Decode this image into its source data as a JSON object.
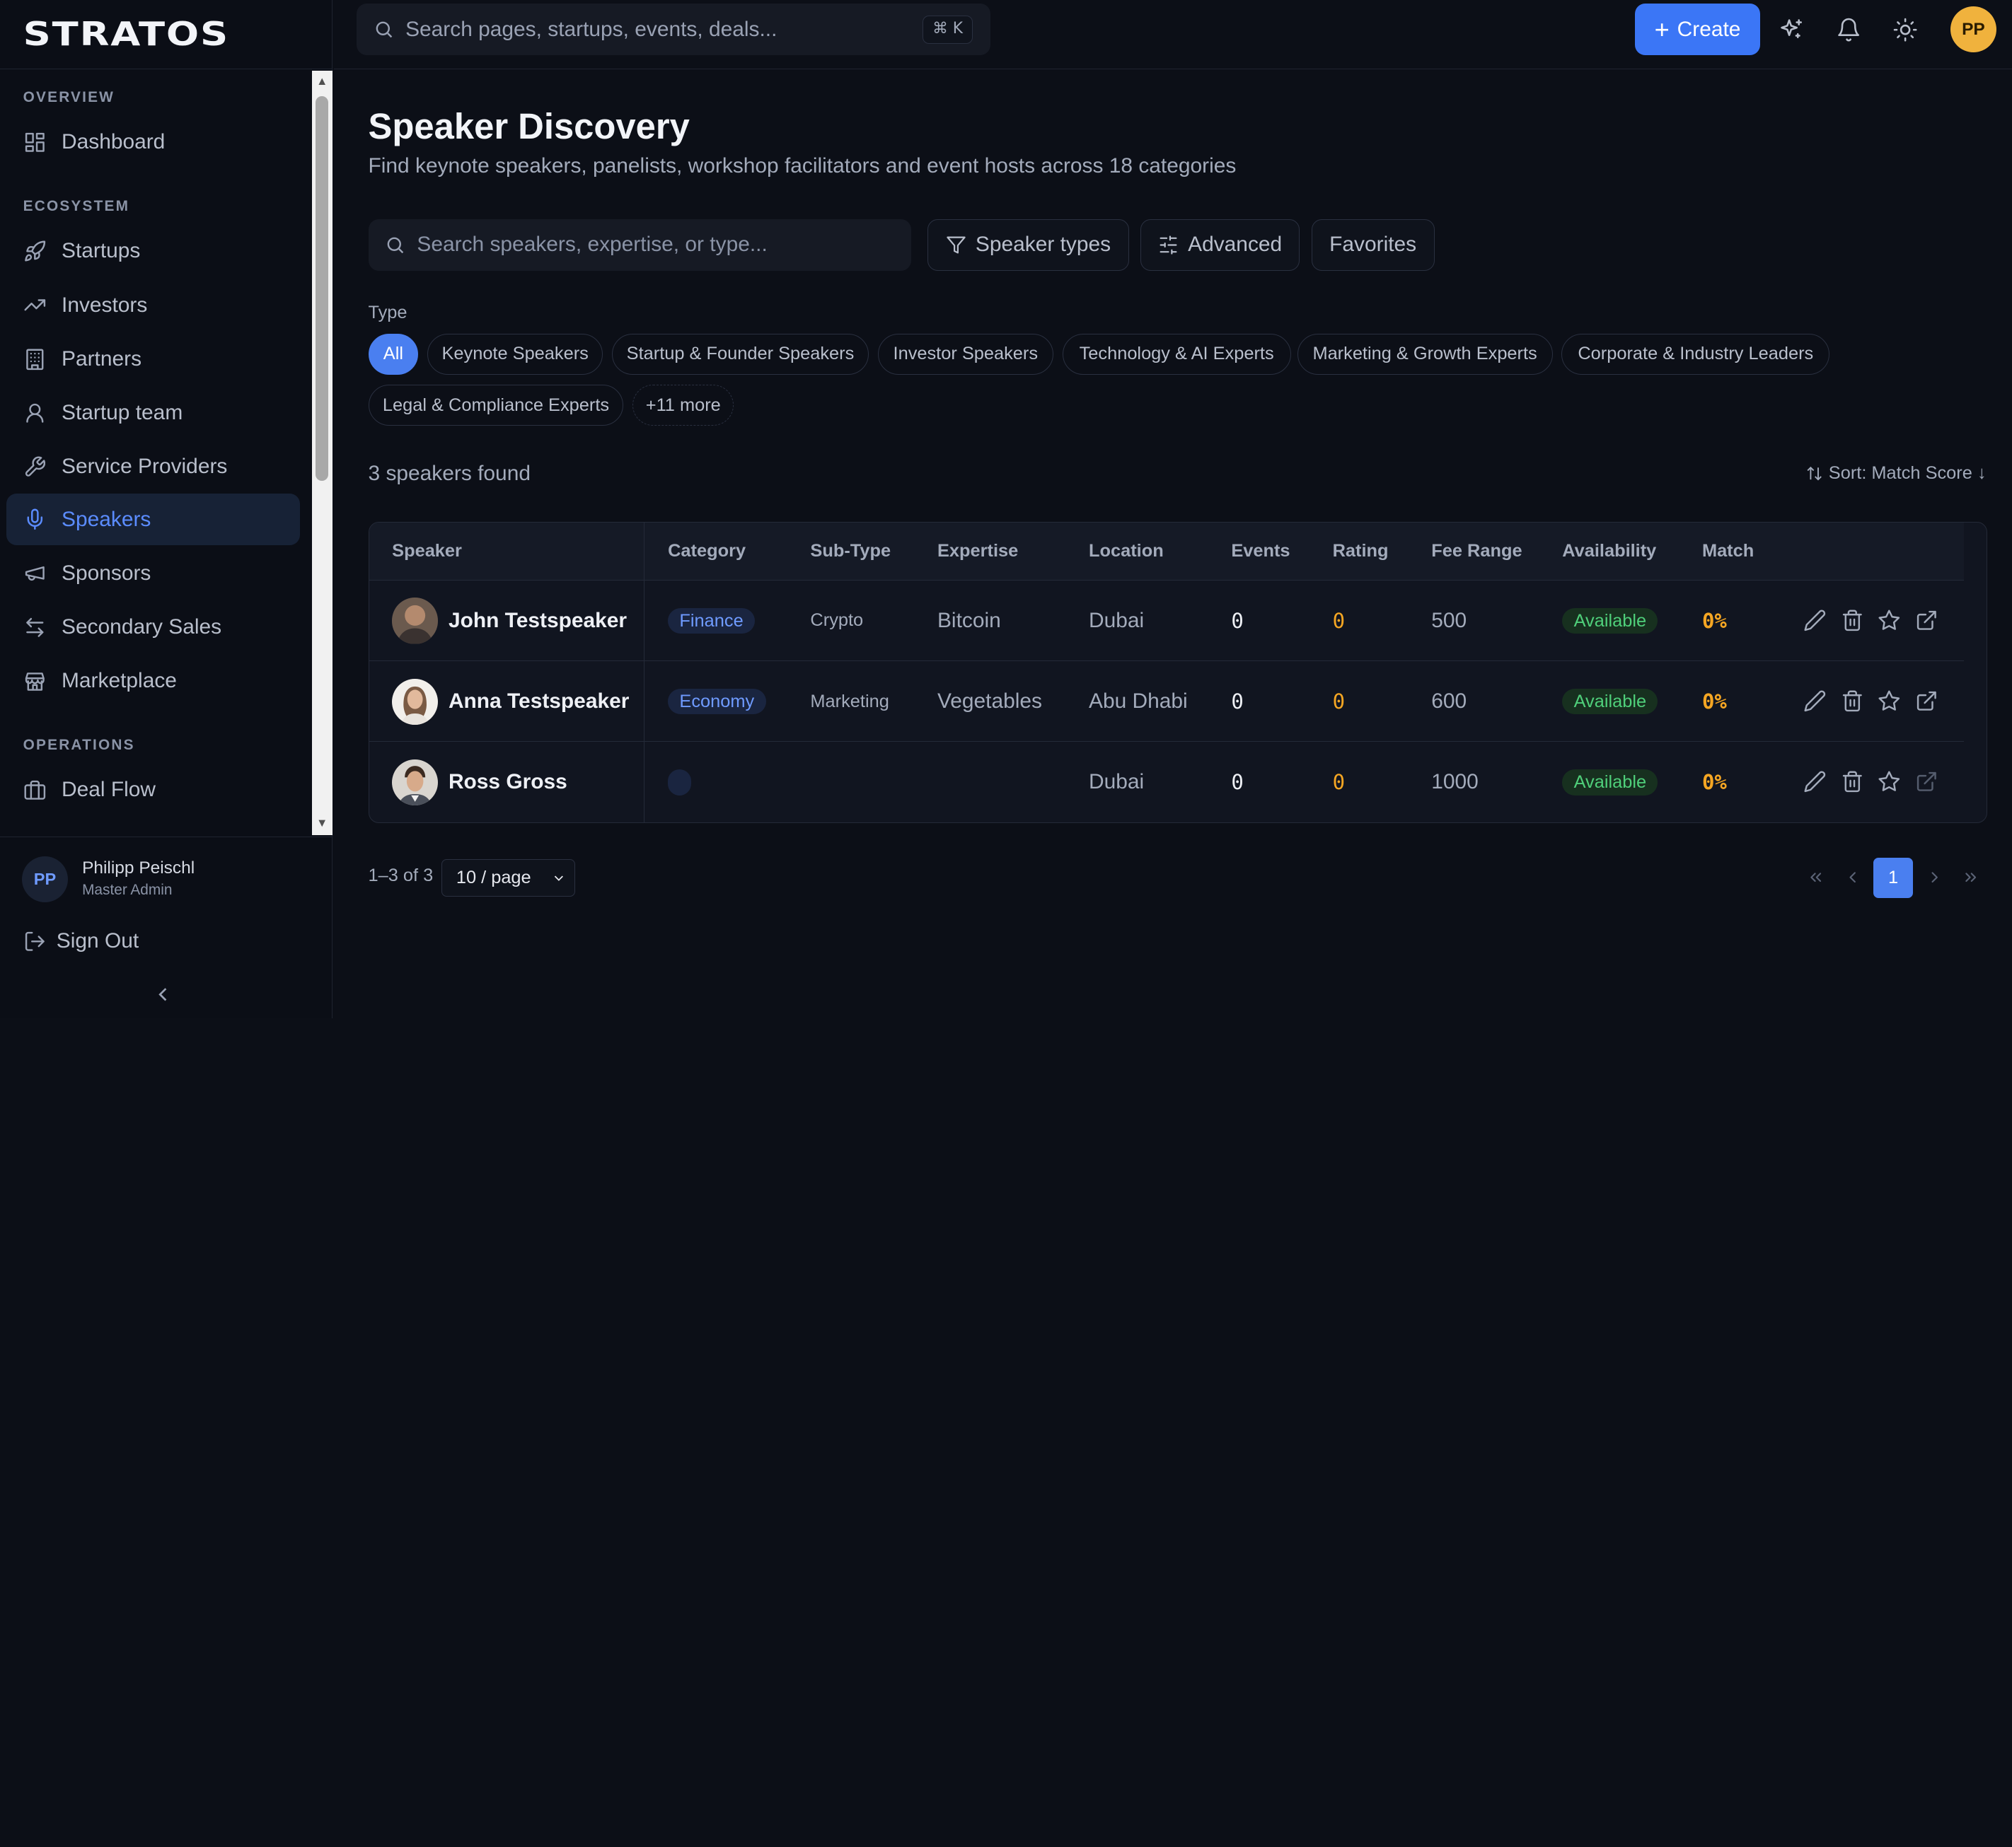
{
  "app": {
    "logo": "STRATOS"
  },
  "topbar": {
    "search_placeholder": "Search pages, startups, events, deals...",
    "shortcut": "⌘ K",
    "create_label": "Create",
    "user_initials": "PP"
  },
  "sidebar": {
    "section_overview": "OVERVIEW",
    "section_ecosystem": "ECOSYSTEM",
    "section_operations": "OPERATIONS",
    "items": {
      "dashboard": "Dashboard",
      "startups": "Startups",
      "investors": "Investors",
      "partners": "Partners",
      "startup_team": "Startup team",
      "service_providers": "Service Providers",
      "speakers": "Speakers",
      "sponsors": "Sponsors",
      "secondary_sales": "Secondary Sales",
      "marketplace": "Marketplace",
      "deal_flow": "Deal Flow"
    },
    "active_item": "Speakers",
    "user": {
      "initials": "PP",
      "name": "Philipp Peischl",
      "role": "Master Admin"
    },
    "sign_out": "Sign Out"
  },
  "page": {
    "title": "Speaker Discovery",
    "subtitle": "Find keynote speakers, panelists, workshop facilitators and event hosts across 18 categories",
    "search_placeholder": "Search speakers, expertise, or type...",
    "buttons": {
      "speaker_types": "Speaker types",
      "advanced": "Advanced",
      "favorites": "Favorites"
    },
    "type_label": "Type",
    "chips": [
      "All",
      "Keynote Speakers",
      "Startup & Founder Speakers",
      "Investor Speakers",
      "Technology & AI Experts",
      "Marketing & Growth Experts",
      "Corporate & Industry Leaders",
      "Legal & Compliance Experts",
      "+11 more"
    ],
    "active_chip": "All",
    "result_count": "3 speakers found",
    "sort_label": "Sort: Match Score ↓"
  },
  "table": {
    "columns": [
      "Speaker",
      "Category",
      "Sub-Type",
      "Expertise",
      "Location",
      "Events",
      "Rating",
      "Fee Range",
      "Availability",
      "Match"
    ],
    "rows": [
      {
        "name": "John Testspeaker",
        "category": "Finance",
        "subtype": "Crypto",
        "expertise": "Bitcoin",
        "location": "Dubai",
        "events": "0",
        "rating": "0",
        "fee": "500",
        "availability": "Available",
        "match": "0%"
      },
      {
        "name": "Anna Testspeaker",
        "category": "Economy",
        "subtype": "Marketing",
        "expertise": "Vegetables",
        "location": "Abu Dhabi",
        "events": "0",
        "rating": "0",
        "fee": "600",
        "availability": "Available",
        "match": "0%"
      },
      {
        "name": "Ross Gross",
        "category": "",
        "subtype": "",
        "expertise": "",
        "location": "Dubai",
        "events": "0",
        "rating": "0",
        "fee": "1000",
        "availability": "Available",
        "match": "0%"
      }
    ]
  },
  "pagination": {
    "range": "1–3 of 3",
    "page_size": "10 / page",
    "current_page": "1"
  },
  "colors": {
    "accent": "#3b76f6",
    "background": "#0c0f17",
    "available": "#4fcf7a",
    "highlight": "#f5a623",
    "avatar_user": "#f0b23d"
  }
}
